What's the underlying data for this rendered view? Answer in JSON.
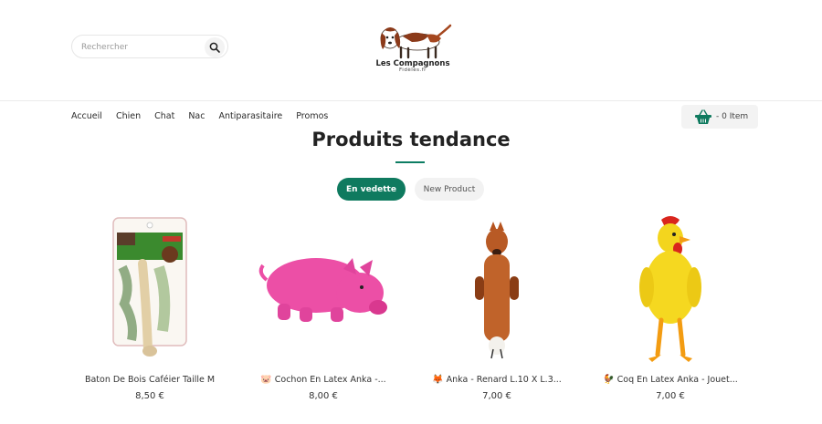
{
  "header": {
    "search": {
      "placeholder": "Rechercher",
      "value": ""
    },
    "logo": {
      "title": "Les Compagnons",
      "subtitle": "Fidèles.fr"
    }
  },
  "nav": {
    "items": [
      {
        "label": "Accueil"
      },
      {
        "label": "Chien"
      },
      {
        "label": "Chat"
      },
      {
        "label": "Nac"
      },
      {
        "label": "Antiparasitaire"
      },
      {
        "label": "Promos"
      }
    ]
  },
  "cart": {
    "label": "- 0 Item",
    "accent_color": "#0f7a5f"
  },
  "section": {
    "title": "Produits tendance",
    "tabs": [
      {
        "label": "En vedette",
        "active": true
      },
      {
        "label": "New Product",
        "active": false
      }
    ]
  },
  "products": [
    {
      "name": "Baton De Bois Caféier Taille M",
      "emoji": "",
      "price": "8,50 €",
      "image": "wood-stick-package"
    },
    {
      "name": "Cochon En Latex Anka -...",
      "emoji": "🐷",
      "price": "8,00 €",
      "image": "pink-latex-pig"
    },
    {
      "name": "Anka - Renard L.10 X L.3...",
      "emoji": "🦊",
      "price": "7,00 €",
      "image": "plush-fox"
    },
    {
      "name": "Coq En Latex Anka - Jouet...",
      "emoji": "🐓",
      "price": "7,00 €",
      "image": "latex-rooster"
    }
  ],
  "colors": {
    "accent": "#0f7a5f",
    "text": "#222222"
  }
}
